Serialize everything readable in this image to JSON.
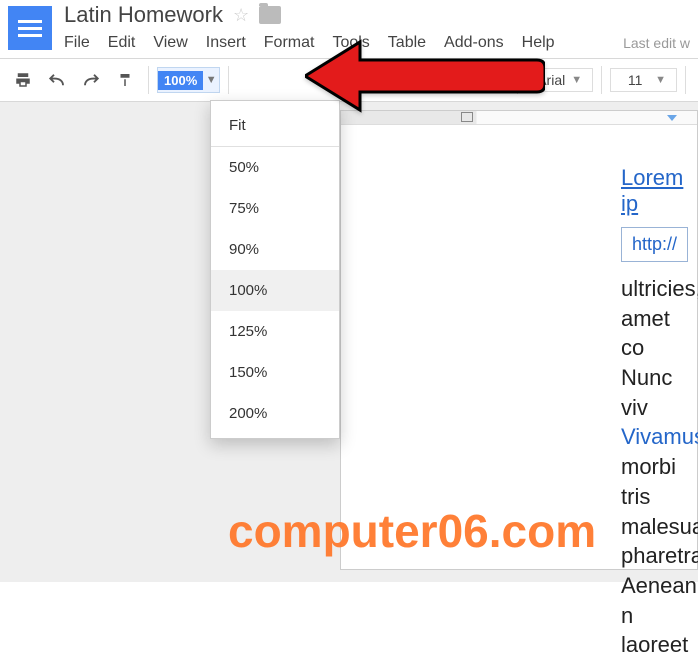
{
  "header": {
    "title": "Latin Homework",
    "menu": [
      "File",
      "Edit",
      "View",
      "Insert",
      "Format",
      "Tools",
      "Table",
      "Add-ons",
      "Help"
    ],
    "last_edit": "Last edit w"
  },
  "toolbar": {
    "zoom_value": "100%",
    "text_style": "text",
    "font": "Arial",
    "font_size": "11"
  },
  "zoom_dropdown": {
    "fit": "Fit",
    "options": [
      "50%",
      "75%",
      "90%",
      "100%",
      "125%",
      "150%",
      "200%"
    ],
    "selected": "100%"
  },
  "document": {
    "link_text": "Lorem ip",
    "url_text": "http://",
    "lines": [
      "ultricies,",
      "amet co",
      "Nunc viv",
      "Vivamus",
      "morbi tris",
      "malesuad",
      "pharetra",
      "Aenean n",
      "laoreet"
    ]
  },
  "watermark": "computer06.com"
}
